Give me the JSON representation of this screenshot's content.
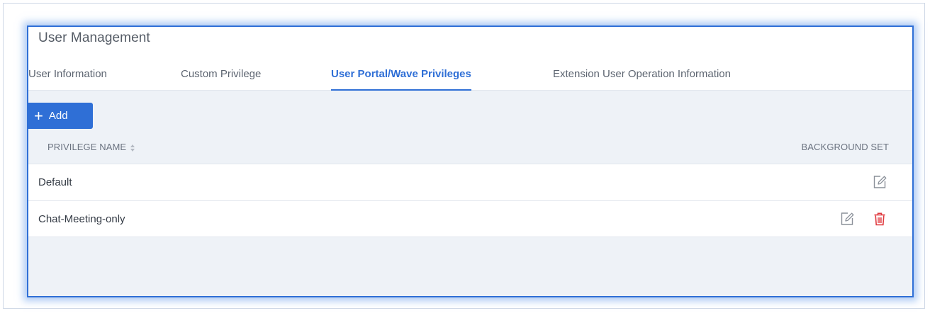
{
  "page": {
    "title": "User Management"
  },
  "tabs": [
    {
      "label": "User Information",
      "active": false
    },
    {
      "label": "Custom Privilege",
      "active": false
    },
    {
      "label": "User Portal/Wave Privileges",
      "active": true
    },
    {
      "label": "Extension User Operation Information",
      "active": false
    }
  ],
  "toolbar": {
    "add_label": "Add",
    "add_icon": "plus-icon"
  },
  "table": {
    "columns": {
      "privilege_name": "PRIVILEGE NAME",
      "background_set": "BACKGROUND SET"
    },
    "rows": [
      {
        "name": "Default",
        "actions": [
          "edit-icon"
        ]
      },
      {
        "name": "Chat-Meeting-only",
        "actions": [
          "edit-icon",
          "trash-icon"
        ]
      }
    ]
  },
  "colors": {
    "accent": "#2f6fd6",
    "delete": "#e0393e",
    "icon_gray": "#8a9099"
  }
}
